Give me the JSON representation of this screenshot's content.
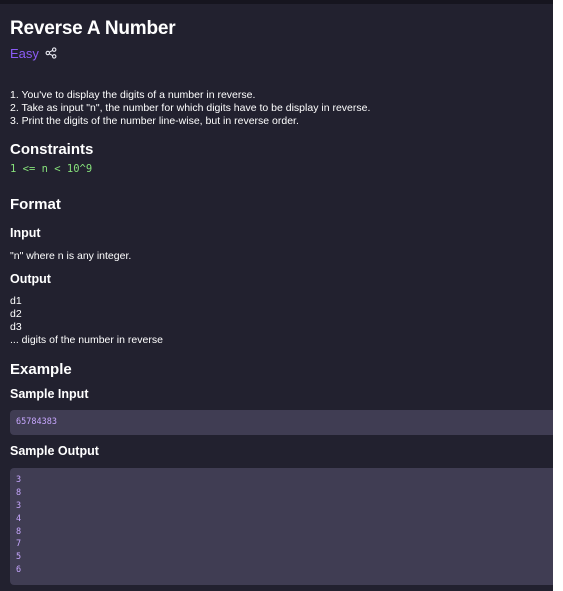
{
  "problem": {
    "title": "Reverse A Number",
    "difficulty": "Easy",
    "description": [
      "1. You've to display the digits of a number in reverse.",
      "2. Take as input \"n\", the number for which digits have to be display in reverse.",
      "3. Print the digits of the number line-wise, but in reverse order."
    ]
  },
  "constraints": {
    "heading": "Constraints",
    "text": "1 <= n < 10^9"
  },
  "format": {
    "heading": "Format",
    "input_heading": "Input",
    "input_text": "\"n\" where n is any integer.",
    "output_heading": "Output",
    "output_lines": [
      "d1",
      "d2",
      "d3",
      "... digits of the number in reverse"
    ]
  },
  "example": {
    "heading": "Example",
    "sample_input_heading": "Sample Input",
    "sample_input": "65784383",
    "sample_output_heading": "Sample Output",
    "sample_output": [
      "3",
      "8",
      "3",
      "4",
      "8",
      "7",
      "5",
      "6"
    ]
  },
  "icons": {
    "share": "share-icon"
  },
  "colors": {
    "background": "#22212f",
    "difficulty": "#8b5cf6",
    "constraint_text": "#86e07b",
    "code_box": "#403d53",
    "code_text": "#c7a7ff"
  }
}
